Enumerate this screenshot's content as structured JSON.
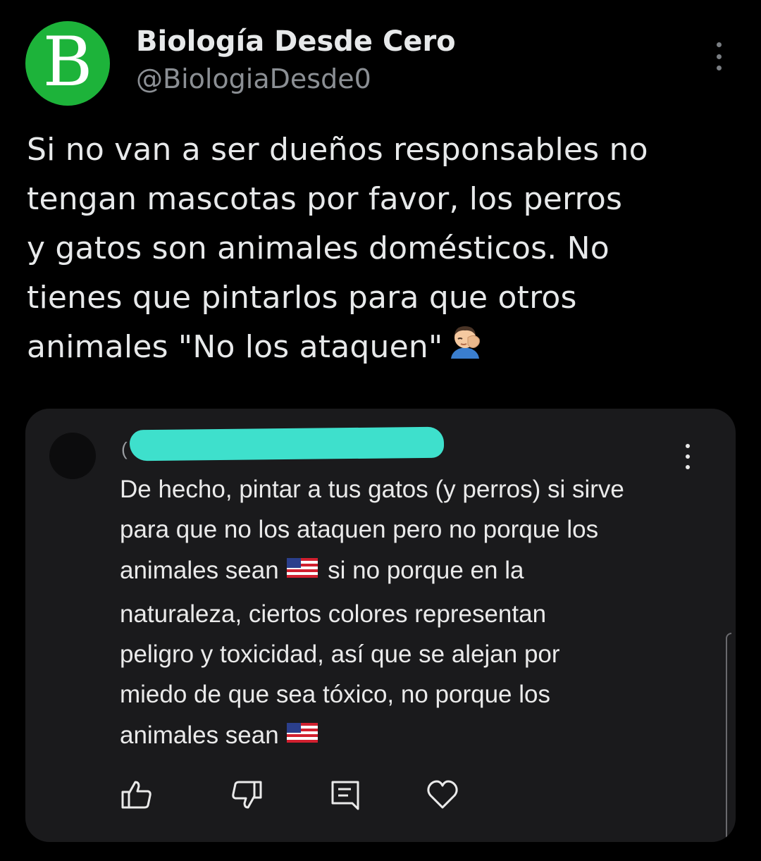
{
  "tweet": {
    "avatar_letter": "B",
    "display_name": "Biología Desde Cero",
    "handle": "@BiologiaDesde0",
    "text_lines": [
      "Si no van a ser dueños responsables no",
      "tengan mascotas por favor, los perros",
      "y gatos son animales domésticos. No",
      "tienes que pintarlos para que otros",
      "animales \"No los ataquen\""
    ],
    "emoji": "facepalm-emoji"
  },
  "quoted_comment": {
    "author_redacted": true,
    "text_lines": [
      "De hecho, pintar a tus gatos (y perros) si sirve",
      "para que no los ataquen pero no porque los",
      "animales sean",
      "si no porque en la",
      "naturaleza, ciertos colores representan",
      "peligro y toxicidad, así que se alejan por",
      "miedo de que sea tóxico, no porque los",
      "animales sean"
    ],
    "flag_icon": "us-flag-emoji",
    "actions": [
      "like-icon",
      "dislike-icon",
      "reply-icon",
      "heart-icon"
    ]
  },
  "colors": {
    "background": "#000000",
    "card": "#1a1a1c",
    "avatar": "#1db33a",
    "redaction": "#3ee0cc",
    "handle": "#8b8f94"
  }
}
